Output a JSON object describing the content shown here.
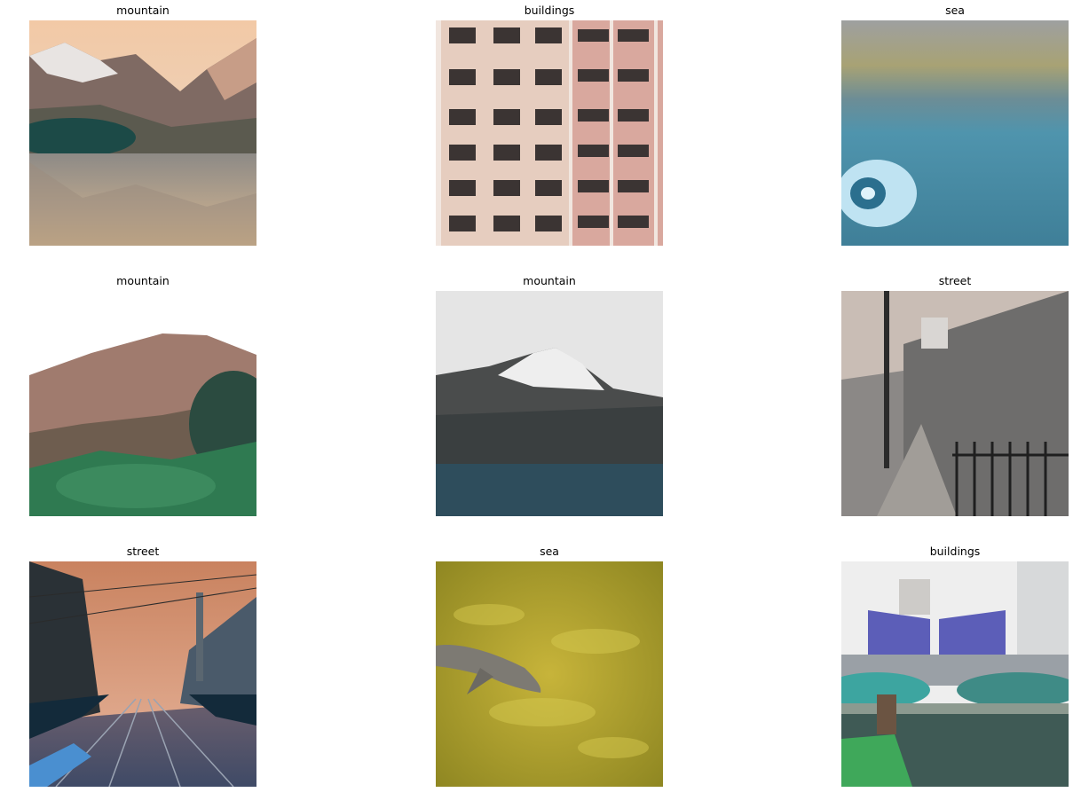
{
  "panels": [
    {
      "label": "mountain",
      "scene": "Lake with snowy mountains and reflection"
    },
    {
      "label": "buildings",
      "scene": "Apartment building facade with balconies"
    },
    {
      "label": "sea",
      "scene": "Seashell on blue sand"
    },
    {
      "label": "mountain",
      "scene": "Grassy hill with shrubs"
    },
    {
      "label": "mountain",
      "scene": "Snow-capped peak above dark ridge"
    },
    {
      "label": "street",
      "scene": "Sidewalk with railings and lamp post"
    },
    {
      "label": "street",
      "scene": "Tram street with overhead wires and mosque"
    },
    {
      "label": "sea",
      "scene": "Dolphin swimming in yellow-green water"
    },
    {
      "label": "buildings",
      "scene": "Office towers with park and pond"
    }
  ]
}
